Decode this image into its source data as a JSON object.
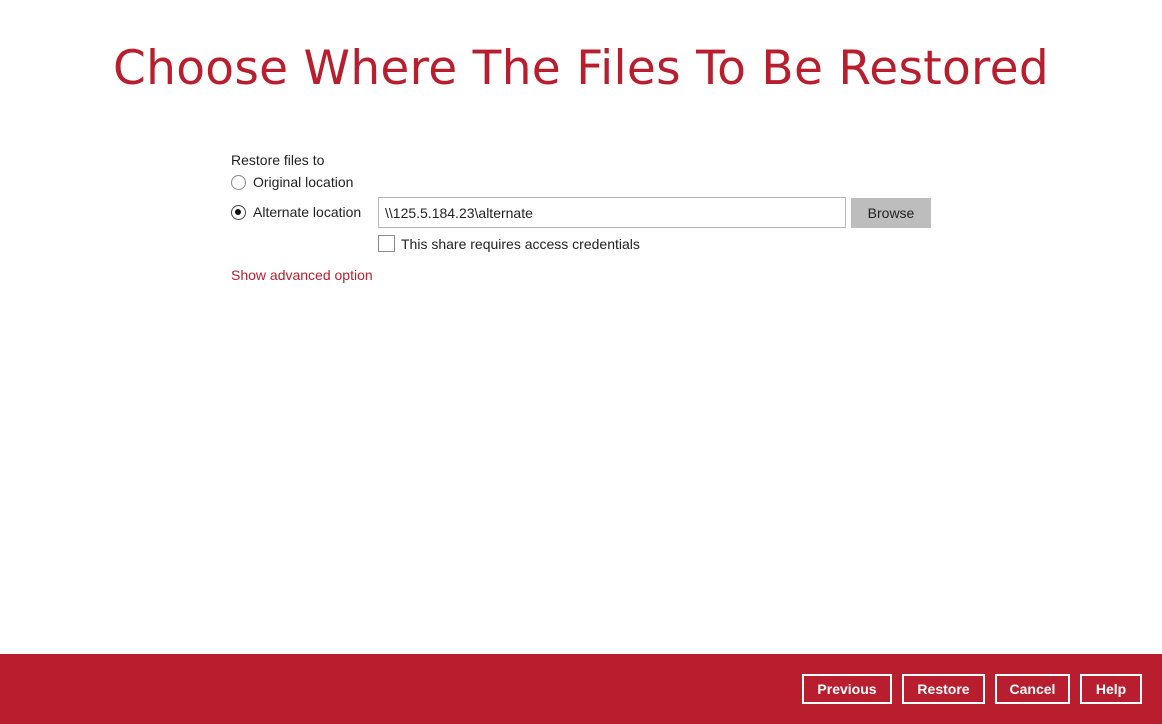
{
  "page": {
    "title": "Choose Where The Files To Be Restored"
  },
  "restore_form": {
    "section_label": "Restore files to",
    "options": [
      {
        "label": "Original location",
        "selected": false
      },
      {
        "label": "Alternate location",
        "selected": true
      }
    ],
    "path_value": "\\\\125.5.184.23\\alternate",
    "browse_label": "Browse",
    "credentials_label": "This share requires access credentials",
    "credentials_checked": false,
    "advanced_link": "Show advanced option"
  },
  "footer": {
    "previous_label": "Previous",
    "restore_label": "Restore",
    "cancel_label": "Cancel",
    "help_label": "Help"
  },
  "colors": {
    "brand_red": "#b81e2d",
    "button_gray": "#bdbdbd"
  }
}
